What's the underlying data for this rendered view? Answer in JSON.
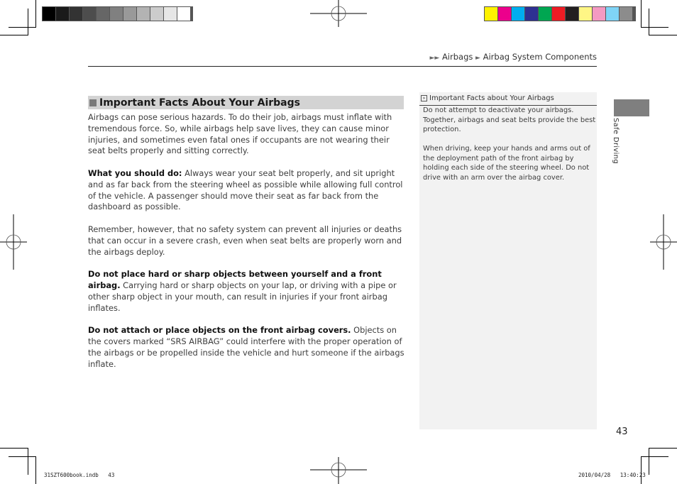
{
  "print_marks": {
    "gray_swatches": [
      "#000000",
      "#1a1a1a",
      "#333333",
      "#4d4d4d",
      "#666666",
      "#808080",
      "#999999",
      "#b3b3b3",
      "#cccccc",
      "#e6e6e6",
      "#ffffff"
    ],
    "color_swatches": [
      "#fff200",
      "#ec008c",
      "#00aeef",
      "#2e3192",
      "#00a651",
      "#ed1c24",
      "#231f20",
      "#fff685",
      "#f49ac2",
      "#7fd4f6",
      "#8c8c8c"
    ]
  },
  "header": {
    "breadcrumb_arrows": "►►",
    "breadcrumb_item1": "Airbags",
    "breadcrumb_sep": "►",
    "breadcrumb_item2": "Airbag System Components"
  },
  "section": {
    "title": "Important Facts About Your Airbags",
    "paragraphs": [
      {
        "bold": "",
        "text": "Airbags can pose serious hazards. To do their job, airbags must inflate with tremendous force. So, while airbags help save lives, they can cause minor injuries, and sometimes even fatal ones if occupants are not wearing their seat belts properly and sitting correctly."
      },
      {
        "bold": "What you should do:",
        "text": " Always wear your seat belt properly, and sit upright and as far back from the steering wheel as possible while allowing full control of the vehicle. A passenger should move their seat as far back from the dashboard as possible."
      },
      {
        "bold": "",
        "text": "Remember, however, that no safety system can prevent all injuries or deaths that can occur in a severe crash, even when seat belts are properly worn and the airbags deploy."
      },
      {
        "bold": "Do not place hard or sharp objects between yourself and a front airbag.",
        "text": " Carrying hard or sharp objects on your lap, or driving with a pipe or other sharp object in your mouth, can result in injuries if your front airbag inflates."
      },
      {
        "bold": "Do not attach or place objects on the front airbag covers.",
        "text": " Objects on the covers marked “SRS AIRBAG” could interfere with the proper operation of the airbags or be propelled inside the vehicle and hurt someone if the airbags inflate."
      }
    ]
  },
  "sidebar_note": {
    "icon": "»",
    "title": "Important Facts about Your Airbags",
    "paragraphs": [
      "Do not attempt to deactivate your airbags. Together, airbags and seat belts provide the best protection.",
      "When driving, keep your hands and arms out of the deployment path of the front airbag by holding each side of the steering wheel. Do not drive with an arm over the airbag cover."
    ]
  },
  "side_tab": {
    "label": "Safe Driving"
  },
  "page_number": "43",
  "footer": {
    "file": "31SZT600book.indb   43",
    "timestamp": "2010/04/28   13:40:23"
  }
}
